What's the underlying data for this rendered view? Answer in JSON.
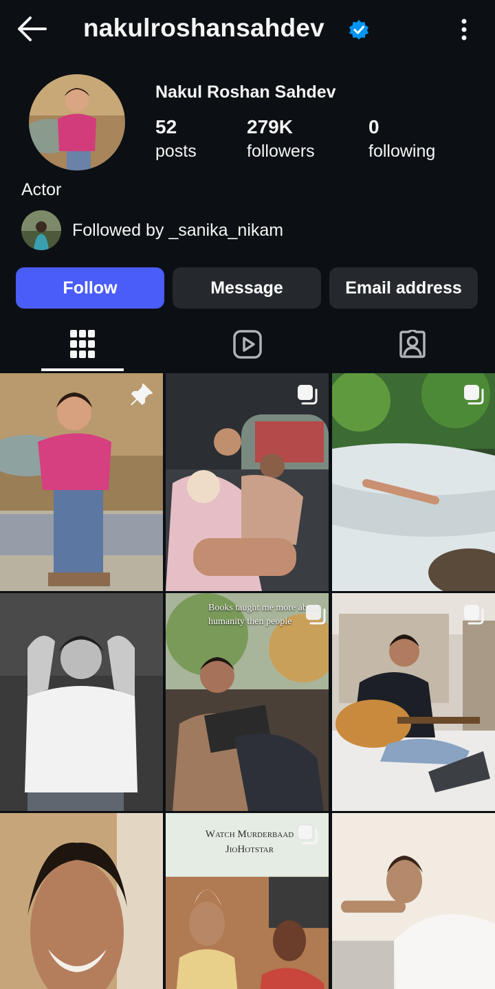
{
  "header": {
    "username": "nakulroshansahdev",
    "verified_icon": "verified-badge-icon",
    "back_icon": "arrow-left-icon",
    "more_icon": "more-vertical-icon"
  },
  "profile": {
    "full_name": "Nakul Roshan Sahdev",
    "stats": {
      "posts": {
        "value": "52",
        "label": "posts"
      },
      "followers": {
        "value": "279K",
        "label": "followers"
      },
      "following": {
        "value": "0",
        "label": "following"
      }
    },
    "bio": "Actor",
    "followed_by": "Followed by _sanika_nikam"
  },
  "actions": {
    "follow": "Follow",
    "message": "Message",
    "email": "Email address"
  },
  "tabs": [
    {
      "icon": "grid-icon",
      "active": true
    },
    {
      "icon": "reels-icon",
      "active": false
    },
    {
      "icon": "tagged-icon",
      "active": false
    }
  ],
  "posts": [
    {
      "badge": "pin-icon"
    },
    {
      "badge": "carousel-icon"
    },
    {
      "badge": "carousel-icon"
    },
    {
      "badge": ""
    },
    {
      "badge": "carousel-icon",
      "caption_lines": [
        "Books taught me more about",
        "humanity then people"
      ]
    },
    {
      "badge": "carousel-icon"
    },
    {
      "badge": ""
    },
    {
      "badge": "carousel-icon",
      "caption_lines": [
        "Watch Murderbaad",
        "JioHotstar"
      ]
    },
    {
      "badge": ""
    }
  ],
  "colors": {
    "background": "#0c1014",
    "follow_button": "#4a5df9",
    "secondary_button": "#25292e",
    "verified": "#0095f6"
  }
}
